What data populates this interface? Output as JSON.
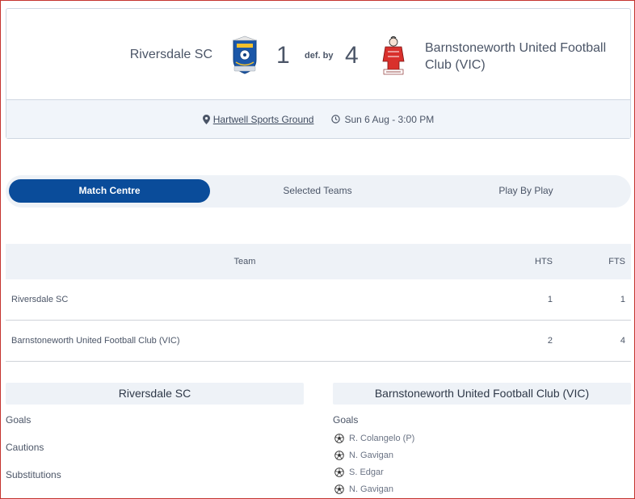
{
  "match": {
    "home_team": "Riversdale SC",
    "away_team": "Barnstoneworth United Football Club (VIC)",
    "home_score": "1",
    "away_score": "4",
    "result_text": "def. by",
    "venue": "Hartwell Sports Ground",
    "datetime": "Sun 6 Aug - 3:00 PM"
  },
  "tabs": [
    {
      "label": "Match Centre",
      "active": true
    },
    {
      "label": "Selected Teams",
      "active": false
    },
    {
      "label": "Play By Play",
      "active": false
    }
  ],
  "score_table": {
    "headers": {
      "team": "Team",
      "hts": "HTS",
      "fts": "FTS"
    },
    "rows": [
      {
        "team": "Riversdale SC",
        "hts": "1",
        "fts": "1"
      },
      {
        "team": "Barnstoneworth United Football Club (VIC)",
        "hts": "2",
        "fts": "4"
      }
    ]
  },
  "home_panel": {
    "title": "Riversdale SC",
    "sections": [
      "Goals",
      "Cautions",
      "Substitutions"
    ]
  },
  "away_panel": {
    "title": "Barnstoneworth United Football Club (VIC)",
    "goals_label": "Goals",
    "goals": [
      "R. Colangelo (P)",
      "N. Gavigan",
      "S. Edgar",
      "N. Gavigan"
    ]
  },
  "colors": {
    "accent": "#0a4c9a",
    "panel_bg": "#eef2f7",
    "home_logo": "#1b57a8",
    "away_logo": "#d9302c"
  },
  "icons": {
    "venue": "map-pin-icon",
    "time": "clock-icon",
    "goal": "soccer-ball-icon"
  }
}
